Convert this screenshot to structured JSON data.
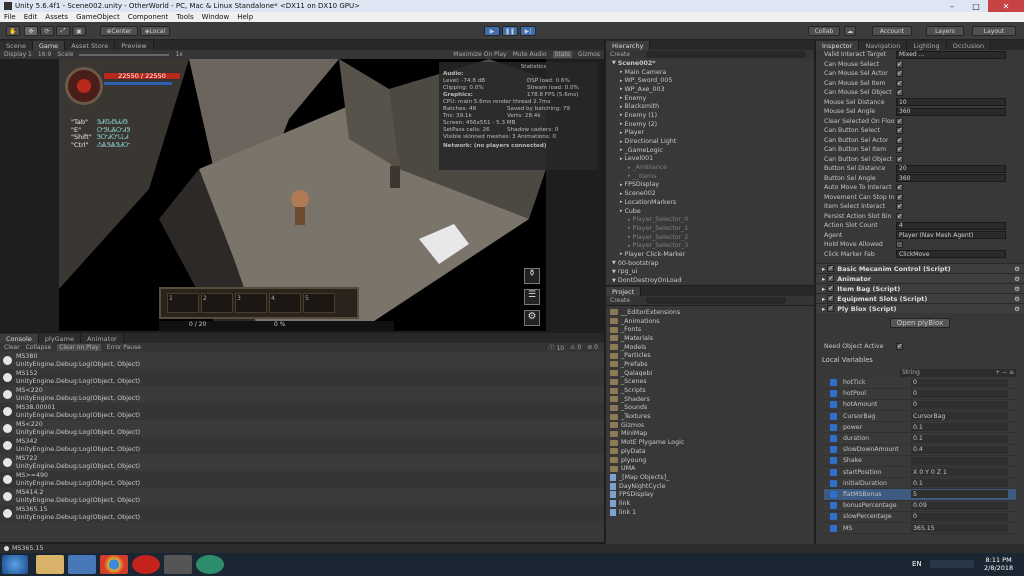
{
  "window": {
    "title": "Unity 5.6.4f1 - Scene002.unity - OtherWorld - PC, Mac & Linux Standalone* <DX11 on DX10 GPU>"
  },
  "menu": [
    "File",
    "Edit",
    "Assets",
    "GameObject",
    "Component",
    "Tools",
    "Window",
    "Help"
  ],
  "toolbar": {
    "center": "Center",
    "local": "Local",
    "collab": "Collab",
    "account": "Account",
    "layers": "Layers",
    "layout": "Layout"
  },
  "game_tabs": {
    "scene": "Scene",
    "game": "Game",
    "asset_store": "Asset Store",
    "preview": "Preview"
  },
  "game_bar": {
    "display": "Display 1",
    "aspect": "16:9",
    "scale_label": "Scale",
    "scale_value": "1x",
    "maximize": "Maximize On Play",
    "mute": "Mute Audio",
    "stats": "Stats",
    "gizmos": "Gizmos"
  },
  "hud": {
    "hp": "22550 / 22550",
    "keys": [
      "\"Tab\"",
      "\"E\"",
      "\"Shift\"",
      "\"Ctrl\""
    ],
    "key_values": [
      "ᏕᏗᏬᏗᏕᏗᏗᏕ",
      "ᏅᏕᏓᏜᏅᏗᏕ",
      "ᏕᏅᏗᏅᏓᏞᏗ",
      "ᏱᏜᏕᏜᏕᏗᏅ"
    ],
    "slots": [
      "1",
      "2",
      "3",
      "4",
      "5"
    ],
    "left_counter": "0 / 20",
    "right_counter": "0 %"
  },
  "stats": {
    "title": "Statistics",
    "audio_h": "Audio:",
    "level": "Level: -74.8 dB",
    "clipping": "Clipping: 0.0%",
    "dsp": "DSP load: 0.6%",
    "stream": "Stream load: 0.0%",
    "graphics_h": "Graphics:",
    "fps": "178.8 FPS (5.6ms)",
    "cpu": "CPU: main 5.6ms  render thread 2.7ms",
    "batches": "Batches: 48",
    "saved": "Saved by batching: 79",
    "tris": "Tris: 39.1k",
    "verts": "Verts: 28.4k",
    "screen": "Screen: 456x551 - 5.3 MB",
    "setpass": "SetPass calls: 26",
    "shadow": "Shadow casters: 0",
    "skinned": "Visible skinned meshes: 3  Animations: 0",
    "network": "Network: (no players connected)"
  },
  "console_tabs": {
    "console": "Console",
    "plygame": "plyGame",
    "animator": "Animator"
  },
  "console_bar": {
    "clear": "Clear",
    "collapse": "Collapse",
    "clear_on_play": "Clear on Play",
    "error_pause": "Error Pause",
    "info_count": "10",
    "warn_count": "0",
    "err_count": "0"
  },
  "console_rows": [
    {
      "a": "MS380",
      "b": "UnityEngine.Debug:Log(Object, Object)"
    },
    {
      "a": "MS152",
      "b": "UnityEngine.Debug:Log(Object, Object)"
    },
    {
      "a": "MS<220",
      "b": "UnityEngine.Debug:Log(Object, Object)"
    },
    {
      "a": "MS38.00001",
      "b": "UnityEngine.Debug:Log(Object, Object)"
    },
    {
      "a": "MS<220",
      "b": "UnityEngine.Debug:Log(Object, Object)"
    },
    {
      "a": "MS342",
      "b": "UnityEngine.Debug:Log(Object, Object)"
    },
    {
      "a": "MS722",
      "b": "UnityEngine.Debug:Log(Object, Object)"
    },
    {
      "a": "MS>=490",
      "b": "UnityEngine.Debug:Log(Object, Object)"
    },
    {
      "a": "MS414.2",
      "b": "UnityEngine.Debug:Log(Object, Object)"
    },
    {
      "a": "MS365.15",
      "b": "UnityEngine.Debug:Log(Object, Object)"
    }
  ],
  "status_line": "MS365.15",
  "hierarchy": {
    "tab": "Hierarchy",
    "create": "Create",
    "items": [
      {
        "t": "Scene002*",
        "d": 0
      },
      {
        "t": "Main Camera",
        "d": 1
      },
      {
        "t": "WP_Sword_005",
        "d": 1
      },
      {
        "t": "WP_Axe_003",
        "d": 1
      },
      {
        "t": "Enemy",
        "d": 1
      },
      {
        "t": "Blacksmith",
        "d": 1
      },
      {
        "t": "Enemy (1)",
        "d": 1
      },
      {
        "t": "Enemy (2)",
        "d": 1
      },
      {
        "t": "Player",
        "d": 1
      },
      {
        "t": "Directional Light",
        "d": 1
      },
      {
        "t": "_GameLogic",
        "d": 1
      },
      {
        "t": "Level001",
        "d": 1
      },
      {
        "t": "_Ambiance",
        "d": 2
      },
      {
        "t": "__Items",
        "d": 2
      },
      {
        "t": "FPSDisplay",
        "d": 1
      },
      {
        "t": "Scene002",
        "d": 1
      },
      {
        "t": "LocationMarkers",
        "d": 1
      },
      {
        "t": "Cube",
        "d": 1
      },
      {
        "t": "Player_Selector_0",
        "d": 2
      },
      {
        "t": "Player_Selector_1",
        "d": 2
      },
      {
        "t": "Player_Selector_2",
        "d": 2
      },
      {
        "t": "Player_Selector_3",
        "d": 2
      },
      {
        "t": "Player Click-Marker",
        "d": 1
      },
      {
        "t": "00-bootstrap",
        "d": 0
      },
      {
        "t": "rpg_ui",
        "d": 0
      },
      {
        "t": "DontDestroyOnLoad",
        "d": 0
      }
    ]
  },
  "project": {
    "tab": "Project",
    "create": "Create",
    "items": [
      {
        "t": "__EditorExtensions",
        "f": 1
      },
      {
        "t": "_Animations",
        "f": 1
      },
      {
        "t": "_Fonts",
        "f": 1
      },
      {
        "t": "_Materials",
        "f": 1
      },
      {
        "t": "_Models",
        "f": 1
      },
      {
        "t": "_Particles",
        "f": 1
      },
      {
        "t": "_Prefabs",
        "f": 1
      },
      {
        "t": "_Qalaqebi",
        "f": 1
      },
      {
        "t": "_Scenes",
        "f": 1
      },
      {
        "t": "_Scripts",
        "f": 1
      },
      {
        "t": "_Shaders",
        "f": 1
      },
      {
        "t": "_Sounds",
        "f": 1
      },
      {
        "t": "_Textures",
        "f": 1
      },
      {
        "t": "Gizmos",
        "f": 1
      },
      {
        "t": "MiniMap",
        "f": 1
      },
      {
        "t": "MotE Plygame Logic",
        "f": 1
      },
      {
        "t": "plyData",
        "f": 1
      },
      {
        "t": "plyoung",
        "f": 1
      },
      {
        "t": "UMA",
        "f": 1
      },
      {
        "t": "_[Map Objects]_",
        "f": 0
      },
      {
        "t": "DayNightCycle",
        "f": 0
      },
      {
        "t": "FPSDisplay",
        "f": 0
      },
      {
        "t": "link",
        "f": 0
      },
      {
        "t": "link 1",
        "f": 0
      }
    ]
  },
  "inspector_tabs": {
    "inspector": "Inspector",
    "navigation": "Navigation",
    "lighting": "Lighting",
    "occlusion": "Occlusion"
  },
  "inspector_rows": [
    {
      "l": "Valid Interact Target",
      "v": "Mixed ..."
    },
    {
      "l": "Can Mouse Select",
      "c": true
    },
    {
      "l": "Can Mouse Sel Actor",
      "c": true
    },
    {
      "l": "Can Mouse Sel Item",
      "c": true
    },
    {
      "l": "Can Mouse Sel Object",
      "c": true
    },
    {
      "l": "Mouse Sel Distance",
      "v": "10"
    },
    {
      "l": "Mouse Sel Angle",
      "v": "360"
    },
    {
      "l": "Clear Selected On Floo",
      "c": true
    },
    {
      "l": "Can Button Select",
      "c": true
    },
    {
      "l": "Can Button Sel Actor",
      "c": true
    },
    {
      "l": "Can Button Sel Item",
      "c": true
    },
    {
      "l": "Can Button Sel Object",
      "c": true
    },
    {
      "l": "Button Sel Distance",
      "v": "20"
    },
    {
      "l": "Button Sel Angle",
      "v": "360"
    },
    {
      "l": "Auto Move To Interact",
      "c": true
    },
    {
      "l": "Movement Can Stop In",
      "c": true
    },
    {
      "l": "Item Select Interact",
      "c": true
    },
    {
      "l": "Persist Action Slot Bin",
      "c": true
    },
    {
      "l": "Action Slot Count",
      "v": "4"
    },
    {
      "l": "Agent",
      "v": "Player (Nav Mesh Agent)"
    },
    {
      "l": "Hold Move Allowed",
      "c": false
    },
    {
      "l": "Click Marker Fab",
      "v": "ClickMove"
    }
  ],
  "components": [
    "Basic Mecanim Control (Script)",
    "Animator",
    "Item Bag (Script)",
    "Equipment Slots (Script)",
    "Ply Blox (Script)"
  ],
  "open_plyblox": "Open plyBlox",
  "need_object_active": "Need Object Active",
  "local_vars_title": "Local Variables",
  "local_vars_type": "String",
  "local_vars": [
    {
      "n": "hotTick",
      "v": "0"
    },
    {
      "n": "hotPool",
      "v": "0"
    },
    {
      "n": "hotAmount",
      "v": "0"
    },
    {
      "n": "CursorBag",
      "v": "CursorBag"
    },
    {
      "n": "power",
      "v": "0.1"
    },
    {
      "n": "duration",
      "v": "0.1"
    },
    {
      "n": "slowDownAmount",
      "v": "0.4"
    },
    {
      "n": "Shake",
      "v": ""
    },
    {
      "n": "startPosition",
      "v": "X 0     Y 0     Z 1"
    },
    {
      "n": "initialDuration",
      "v": "0.1"
    },
    {
      "n": "flatMSBonus",
      "v": "5"
    },
    {
      "n": "bonusPercentage",
      "v": "0.09"
    },
    {
      "n": "slowPercentage",
      "v": "0"
    },
    {
      "n": "MS",
      "v": "365.15"
    }
  ],
  "tray": {
    "lang": "EN",
    "time": "8:11 PM",
    "date": "2/8/2018"
  },
  "colors": {
    "accent": "#3d6fb0",
    "health": "#b8281c",
    "mana": "#2d62b0"
  }
}
